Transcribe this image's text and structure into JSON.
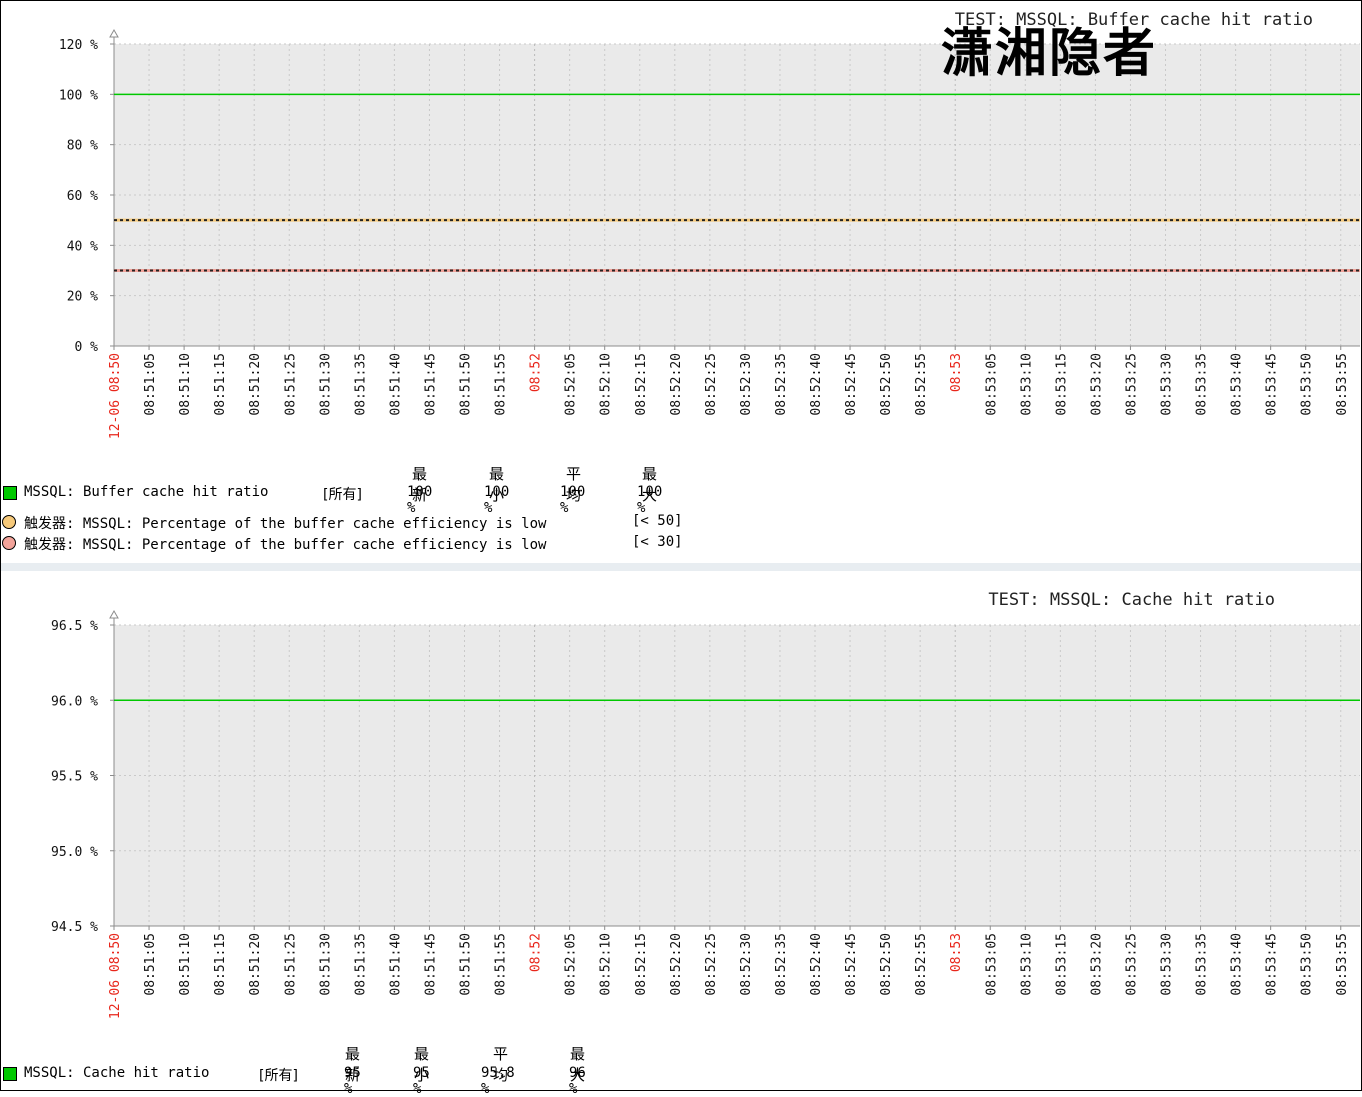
{
  "colors": {
    "plot_bg": "#eaeaea",
    "grid": "#c9c9c9",
    "series": "#00c800",
    "trigger50": "#f6c97a",
    "trigger30": "#f2a39a",
    "red_tick": "#e8261b",
    "axis": "#8c8c8c"
  },
  "watermark": "潇湘隐者",
  "x_ticks": [
    "12-06 08:50",
    "08:51:05",
    "08:51:10",
    "08:51:15",
    "08:51:20",
    "08:51:25",
    "08:51:30",
    "08:51:35",
    "08:51:40",
    "08:51:45",
    "08:51:50",
    "08:51:55",
    "08:52",
    "08:52:05",
    "08:52:10",
    "08:52:15",
    "08:52:20",
    "08:52:25",
    "08:52:30",
    "08:52:35",
    "08:52:40",
    "08:52:45",
    "08:52:50",
    "08:52:55",
    "08:53",
    "08:53:05",
    "08:53:10",
    "08:53:15",
    "08:53:20",
    "08:53:25",
    "08:53:30",
    "08:53:35",
    "08:53:40",
    "08:53:45",
    "08:53:50",
    "08:53:55"
  ],
  "x_ticks_red": [
    "12-06 08:50",
    "08:52",
    "08:53"
  ],
  "stat_headers": {
    "last": "最新",
    "min": "最小",
    "avg": "平均",
    "max": "最大"
  },
  "chart_data": [
    {
      "type": "line",
      "title": "TEST: MSSQL: Buffer cache hit ratio",
      "y_ticks": [
        "120 %",
        "100 %",
        "80 %",
        "60 %",
        "40 %",
        "20 %",
        "0 %"
      ],
      "ylim": [
        0,
        120
      ],
      "grid": true,
      "series": [
        {
          "name": "MSSQL: Buffer cache hit ratio",
          "value": 100,
          "color": "#00c800",
          "scope": "[所有]",
          "last": "100 %",
          "min": "100 %",
          "avg": "100 %",
          "max": "100 %"
        }
      ],
      "triggers": [
        {
          "label": "触发器: MSSQL: Percentage of the buffer cache efficiency is low",
          "threshold": 50,
          "condition": "[< 50]",
          "color": "#f6c97a"
        },
        {
          "label": "触发器: MSSQL: Percentage of the buffer cache efficiency is low",
          "threshold": 30,
          "condition": "[< 30]",
          "color": "#f2a39a"
        }
      ]
    },
    {
      "type": "line",
      "title": "TEST: MSSQL: Cache hit ratio",
      "y_ticks": [
        "96.5 %",
        "96.0 %",
        "95.5 %",
        "95.0 %",
        "94.5 %"
      ],
      "ylim": [
        94.5,
        96.5
      ],
      "grid": true,
      "series": [
        {
          "name": "MSSQL: Cache hit ratio",
          "value": 96,
          "color": "#00c800",
          "scope": "[所有]",
          "last": "95 %",
          "min": "95 %",
          "avg": "95.8 %",
          "max": "96 %"
        }
      ],
      "triggers": []
    }
  ]
}
